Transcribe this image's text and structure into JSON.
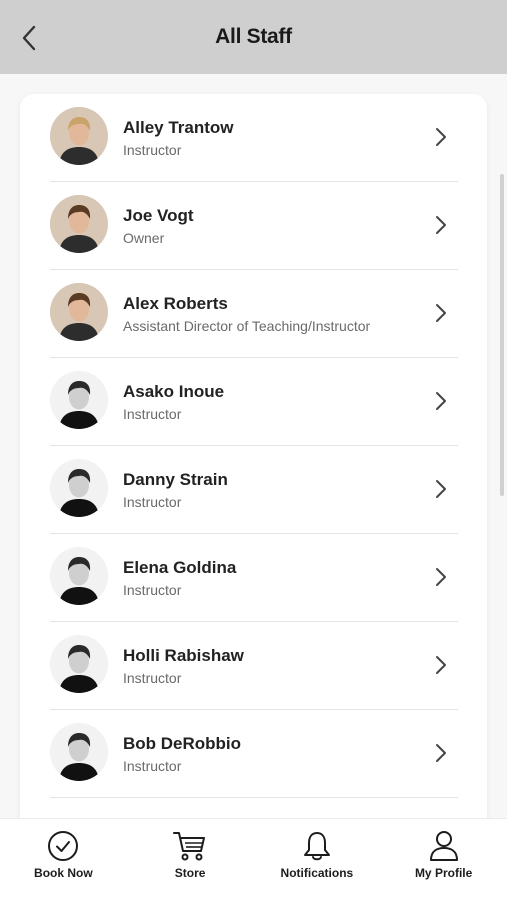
{
  "header": {
    "title": "All Staff",
    "back_icon": "chevron-left-icon"
  },
  "staff": [
    {
      "name": "Alley Trantow",
      "role": "Instructor",
      "photo_style": "color"
    },
    {
      "name": "Joe Vogt",
      "role": "Owner",
      "photo_style": "color"
    },
    {
      "name": "Alex Roberts",
      "role": "Assistant Director of Teaching/Instructor",
      "photo_style": "color"
    },
    {
      "name": "Asako Inoue",
      "role": "Instructor",
      "photo_style": "bw"
    },
    {
      "name": "Danny Strain",
      "role": "Instructor",
      "photo_style": "bw"
    },
    {
      "name": "Elena Goldina",
      "role": "Instructor",
      "photo_style": "bw"
    },
    {
      "name": "Holli Rabishaw",
      "role": "Instructor",
      "photo_style": "bw"
    },
    {
      "name": "Bob DeRobbio",
      "role": "Instructor",
      "photo_style": "bw"
    }
  ],
  "tabs": [
    {
      "label": "Book Now",
      "icon": "check-circle-icon"
    },
    {
      "label": "Store",
      "icon": "cart-icon"
    },
    {
      "label": "Notifications",
      "icon": "bell-icon"
    },
    {
      "label": "My Profile",
      "icon": "user-icon"
    }
  ],
  "colors": {
    "header_bg": "#cfcfcf",
    "card_bg": "#ffffff",
    "divider": "#e4e4e4",
    "text_secondary": "#6a6a6a"
  }
}
